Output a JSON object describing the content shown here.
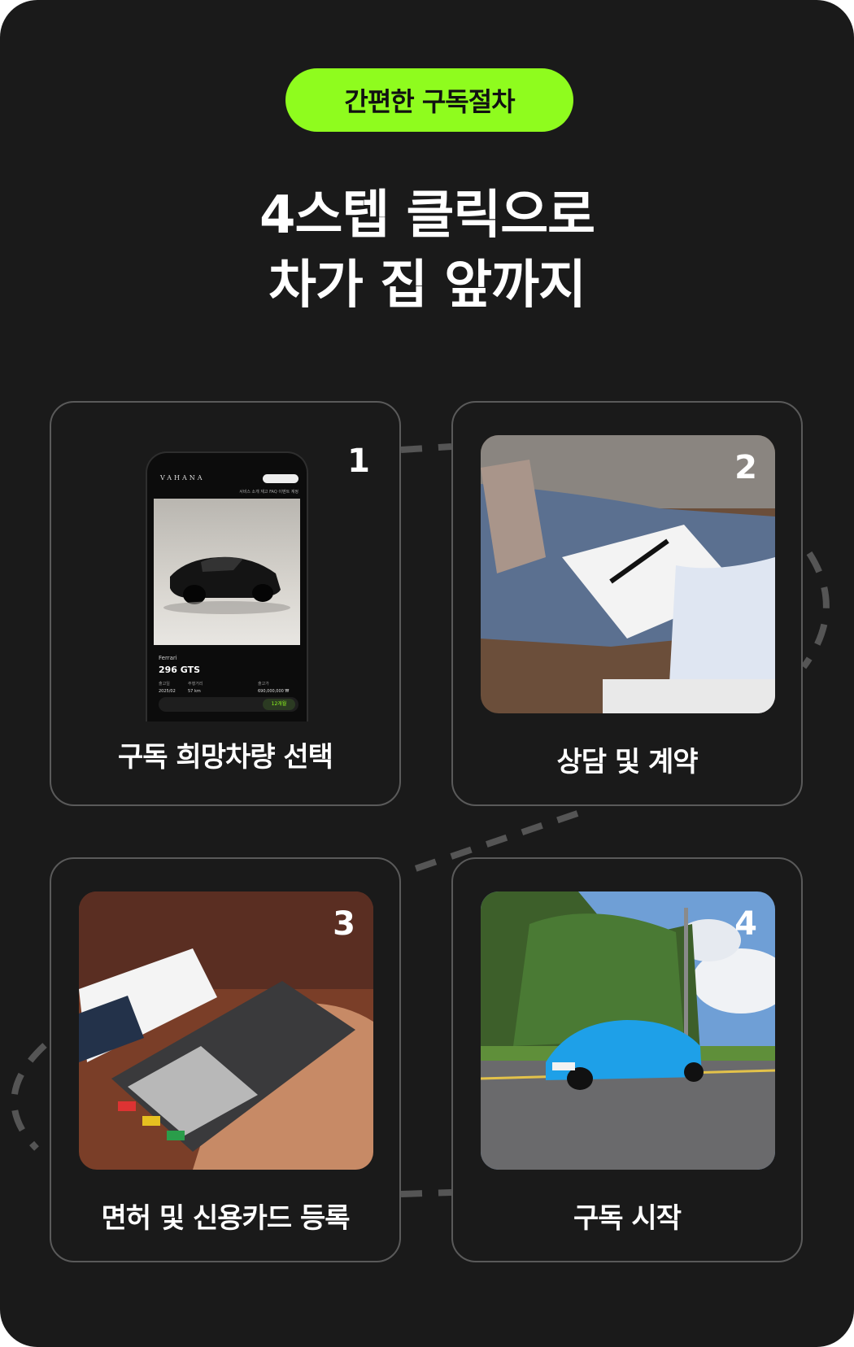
{
  "badge": "간편한 구독절차",
  "headline": {
    "line1": "4스텝 클릭으로",
    "line2": "차가 집 앞까지"
  },
  "colors": {
    "accent": "#8ffc1e",
    "background": "#1a1a1a",
    "card_border": "#5a5a5a"
  },
  "steps": [
    {
      "number": "1",
      "label": "구독 희망차량 선택"
    },
    {
      "number": "2",
      "label": "상담 및 계약"
    },
    {
      "number": "3",
      "label": "면허 및 신용카드 등록"
    },
    {
      "number": "4",
      "label": "구독 시작"
    }
  ],
  "phone_screen": {
    "brand": "VAHANA",
    "nav": "서비스 소개   재고   FAQ   이벤트   계정",
    "make": "Ferrari",
    "model": "296 GTS",
    "specs": [
      {
        "label": "출고일",
        "value": "2025/02"
      },
      {
        "label": "주행거리",
        "value": "57 km"
      },
      {
        "label": "출고가",
        "value": "690,000,000 ₩"
      }
    ],
    "term": "12개월"
  }
}
